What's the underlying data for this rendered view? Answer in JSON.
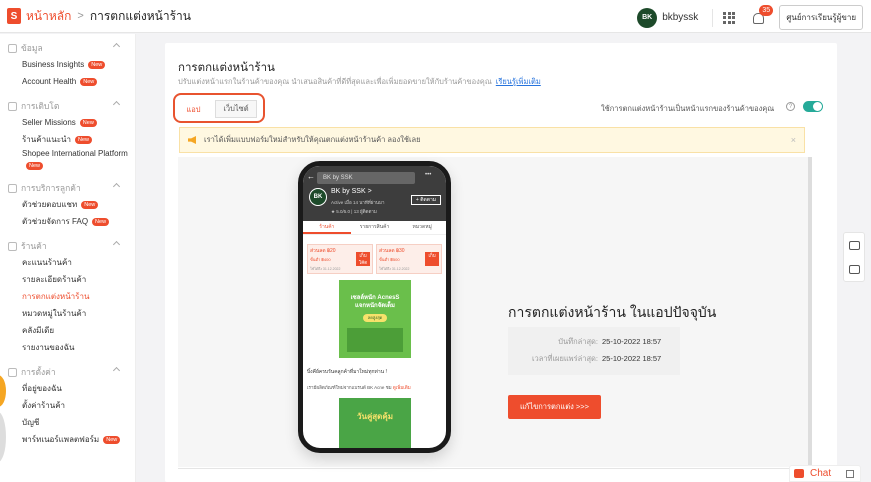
{
  "topbar": {
    "home_label": "หน้าหลัก",
    "separator": ">",
    "current_page": "การตกแต่งหน้าร้าน",
    "avatar_text": "BK",
    "username": "bkbyssk",
    "notification_count": "35",
    "learning_center_label": "ศูนย์การเรียนรู้ผู้ขาย"
  },
  "sidebar": {
    "new_badge": "New",
    "sections": [
      {
        "title": "ข้อมูล",
        "items": [
          {
            "label": "Business Insights",
            "badge": true
          },
          {
            "label": "Account Health",
            "badge": true
          }
        ]
      },
      {
        "title": "การเติบโต",
        "items": [
          {
            "label": "Seller Missions",
            "badge": true
          },
          {
            "label": "ร้านค้าแนะนำ",
            "badge": true
          },
          {
            "label": "Shopee International Platform",
            "badge": true
          }
        ]
      },
      {
        "title": "การบริการลูกค้า",
        "items": [
          {
            "label": "ตัวช่วยตอบแชท",
            "badge": true
          },
          {
            "label": "ตัวช่วยจัดการ FAQ",
            "badge": true
          }
        ]
      },
      {
        "title": "ร้านค้า",
        "items": [
          {
            "label": "คะแนนร้านค้า",
            "badge": false
          },
          {
            "label": "รายละเอียดร้านค้า",
            "badge": false
          },
          {
            "label": "การตกแต่งหน้าร้าน",
            "badge": false,
            "active": true
          },
          {
            "label": "หมวดหมู่ในร้านค้า",
            "badge": false
          },
          {
            "label": "คลังมีเดีย",
            "badge": false
          },
          {
            "label": "รายงานของฉัน",
            "badge": false
          }
        ]
      },
      {
        "title": "การตั้งค่า",
        "items": [
          {
            "label": "ที่อยู่ของฉัน",
            "badge": false
          },
          {
            "label": "ตั้งค่าร้านค้า",
            "badge": false
          },
          {
            "label": "บัญชี",
            "badge": false
          },
          {
            "label": "พาร์ทเนอร์แพลตฟอร์ม",
            "badge": true
          }
        ]
      }
    ]
  },
  "main": {
    "title": "การตกแต่งหน้าร้าน",
    "description": "ปรับแต่งหน้าแรกในร้านค้าของคุณ นำเสนอสินค้าที่ดีที่สุดและเพื่อเพิ่มยอดขายให้กับร้านค้าของคุณ",
    "learn_more": "เรียนรู้เพิ่มเติม",
    "tab_app": "แอป",
    "tab_web": "เว็บไซต์",
    "toggle_label": "ใช้การตกแต่งหน้าร้านเป็นหน้าแรกของร้านค้าของคุณ",
    "toggle_on": true,
    "notice": "เราได้เพิ่มแบบฟอร์มใหม่สำหรับให้คุณตกแต่งหน้าร้านค้า ลองใช้เลย",
    "notice_close": "×",
    "app_section_title": "การตกแต่งหน้าร้าน ในแอปปัจจุบัน",
    "saved_label": "บันทึกล่าสุด:",
    "saved_value": "25-10-2022 18:57",
    "published_label": "เวลาที่เผยแพร่ล่าสุด:",
    "published_value": "25-10-2022 18:57",
    "edit_button": "แก้ไขการตกแต่ง >>>"
  },
  "phone": {
    "search_placeholder": "BK by SSK",
    "back": "←",
    "menu": "•••",
    "logo_text": "BK",
    "shop_name": "BK by SSK >",
    "shop_sub": "Active เมื่อ 14 นาทีที่ผ่านมา",
    "follow_label": "+ ติดตาม",
    "stats": "★ 5.0/5.0 | 13 ผู้ติดตาม",
    "tabs": [
      "ร้านค้า",
      "รายการสินค้า",
      "หมวดหมู่"
    ],
    "vouchers": [
      {
        "amount": "ส่วนลด ฿20",
        "sub": "ขั้นต่ำ ฿400",
        "expiry": "ใช้ได้ถึง 31.12.2022",
        "button": "เก็บโค้ด"
      },
      {
        "amount": "ส่วนลด ฿30",
        "sub": "ขั้นต่ำ ฿500",
        "expiry": "ใช้ได้ถึง 31.12.2022",
        "button": "เก็บ"
      }
    ],
    "banner_title": "เซลล์หนัก AcnesS แจกหนักจัดเต็ม",
    "banner_pill": "ลดสูงสุด",
    "caption": "บิ้งคีย์ครบรันคลูกค้าที่มาใหม่ทุกท่าน !",
    "description": "เรามีผลิตภัณฑ์ใหม่จากแบรนด์ BK Acne ชม",
    "description_link": "ดูเพิ่มเติม",
    "banner2_title": "วันคู่สุดคุ้ม"
  },
  "chat": {
    "label": "Chat"
  },
  "icons": {
    "notice": "speaker-icon",
    "tools": [
      "chart-icon",
      "inbox-icon"
    ]
  },
  "colors": {
    "brand": "#ee4d2d",
    "toggle": "#26aa99",
    "notice_bg": "#fff8e1"
  }
}
